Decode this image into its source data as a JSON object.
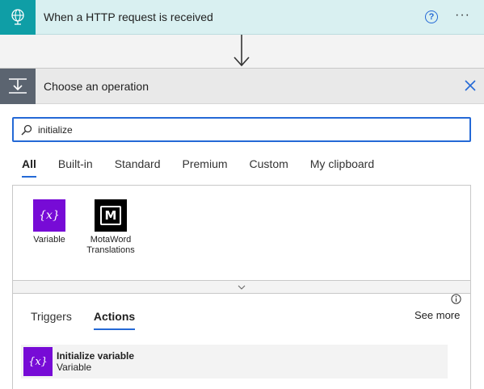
{
  "trigger": {
    "title": "When a HTTP request is received",
    "help_glyph": "?",
    "more_glyph": "···",
    "icon": "globe-icon",
    "color": "#0f9ea6"
  },
  "operation": {
    "title": "Choose an operation",
    "icon": "download-tray-icon",
    "close_icon": "close-icon"
  },
  "search": {
    "value": "initialize",
    "icon": "search-icon"
  },
  "tabs": [
    {
      "label": "All",
      "active": true
    },
    {
      "label": "Built-in",
      "active": false
    },
    {
      "label": "Standard",
      "active": false
    },
    {
      "label": "Premium",
      "active": false
    },
    {
      "label": "Custom",
      "active": false
    },
    {
      "label": "My clipboard",
      "active": false
    }
  ],
  "connectors": [
    {
      "label": "Variable",
      "icon": "variable-icon",
      "color": "#770bd6"
    },
    {
      "label": "MotaWord Translations",
      "icon": "motaword-icon",
      "color": "#000000"
    }
  ],
  "subtabs": [
    {
      "label": "Triggers",
      "active": false
    },
    {
      "label": "Actions",
      "active": true
    }
  ],
  "see_more": "See more",
  "actions": [
    {
      "title": "Initialize variable",
      "subtitle": "Variable",
      "icon": "variable-icon"
    }
  ],
  "variable_glyph": "{x}",
  "motaword_glyph": "M",
  "colors": {
    "accent": "#2469d6",
    "variable": "#770bd6"
  }
}
